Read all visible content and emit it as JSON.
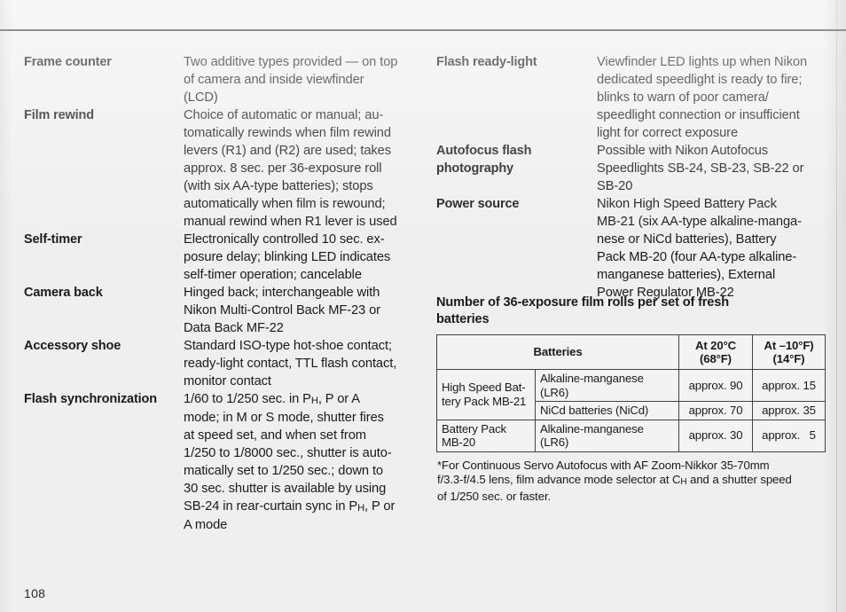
{
  "page": {
    "number": "108"
  },
  "left_column": {
    "rows": [
      {
        "label": "Frame counter",
        "lines": [
          "Two additive types provided — on top",
          "of camera and inside viewfinder",
          "(LCD)"
        ]
      },
      {
        "label": "Film rewind",
        "lines": [
          "Choice of automatic or manual; au-",
          "tomatically rewinds when film rewind",
          "levers (R1) and (R2) are used; takes",
          "approx. 8 sec. per 36-exposure roll",
          "(with six AA-type batteries); stops",
          "automatically when film is rewound;",
          "manual rewind when R1 lever is used"
        ]
      },
      {
        "label": "Self-timer",
        "lines": [
          "Electronically controlled 10 sec. ex-",
          "posure delay; blinking LED indicates",
          "self-timer operation; cancelable"
        ]
      },
      {
        "label": "Camera back",
        "lines": [
          "Hinged back; interchangeable with",
          "Nikon Multi-Control Back MF-23 or",
          "Data Back MF-22"
        ]
      },
      {
        "label": "Accessory shoe",
        "lines": [
          "Standard ISO-type hot-shoe contact;",
          "ready-light contact, TTL flash contact,",
          "monitor contact"
        ]
      },
      {
        "label": "Flash synchronization",
        "lines": [
          "1/60 to 1/250 sec. in P<sub class=\"smallcap\">H</sub>, P or A",
          "mode; in M or S mode, shutter fires",
          "at speed set, and when set from",
          "1/250 to 1/8000 sec., shutter is auto-",
          "matically set to 1/250 sec.; down to",
          "30 sec. shutter is available by using",
          "SB-24 in rear-curtain sync in P<sub class=\"smallcap\">H</sub>, P or",
          "A mode"
        ]
      }
    ]
  },
  "right_column": {
    "rows": [
      {
        "label": "Flash ready-light",
        "lines": [
          "Viewfinder LED lights up when Nikon",
          "dedicated speedlight is ready to fire;",
          "blinks to warn of poor camera/",
          "speedlight connection or insufficient",
          "light for correct exposure"
        ]
      },
      {
        "label": "Autofocus flash photography",
        "label_lines": [
          "Autofocus flash",
          "photography"
        ],
        "lines": [
          "Possible with Nikon Autofocus",
          "Speedlights SB-24, SB-23, SB-22 or",
          "SB-20"
        ]
      },
      {
        "label": "Power source",
        "lines": [
          "Nikon High Speed Battery Pack",
          "MB-21 (six AA-type alkaline-manga-",
          "nese or NiCd batteries), Battery",
          "Pack MB-20 (four AA-type alkaline-",
          "manganese batteries), External",
          "Power Regulator MB-22"
        ]
      }
    ]
  },
  "table_section": {
    "heading_lines": [
      "Number of 36-exposure film rolls per set of fresh",
      "batteries"
    ],
    "headers": {
      "batteries": "Batteries",
      "temp_warm_line1": "At 20°C",
      "temp_warm_line2": "(68°F)",
      "temp_cold_line1": "At –10°F)",
      "temp_cold_line2": "(14°F)"
    },
    "rows": [
      {
        "pack_lines": [
          "High Speed Bat-",
          "tery Pack MB-21"
        ],
        "pack_rowspan": 2,
        "type": "Alkaline-manganese (LR6)",
        "warm": "approx. 90",
        "cold": "approx. 15"
      },
      {
        "type": "NiCd batteries (NiCd)",
        "warm": "approx. 70",
        "cold": "approx. 35"
      },
      {
        "pack_lines": [
          "Battery Pack",
          "MB-20"
        ],
        "pack_rowspan": 1,
        "type": "Alkaline-manganese (LR6)",
        "warm": "approx. 30",
        "cold": "approx.   5"
      }
    ],
    "footnote_lines": [
      "*For Continuous Servo Autofocus with AF Zoom-Nikkor 35-70mm",
      "f/3.3-f/4.5 lens, film advance mode selector at C<sub class=\"smallcap\">H</sub> and a shutter speed",
      "of 1/250 sec. or faster."
    ]
  }
}
